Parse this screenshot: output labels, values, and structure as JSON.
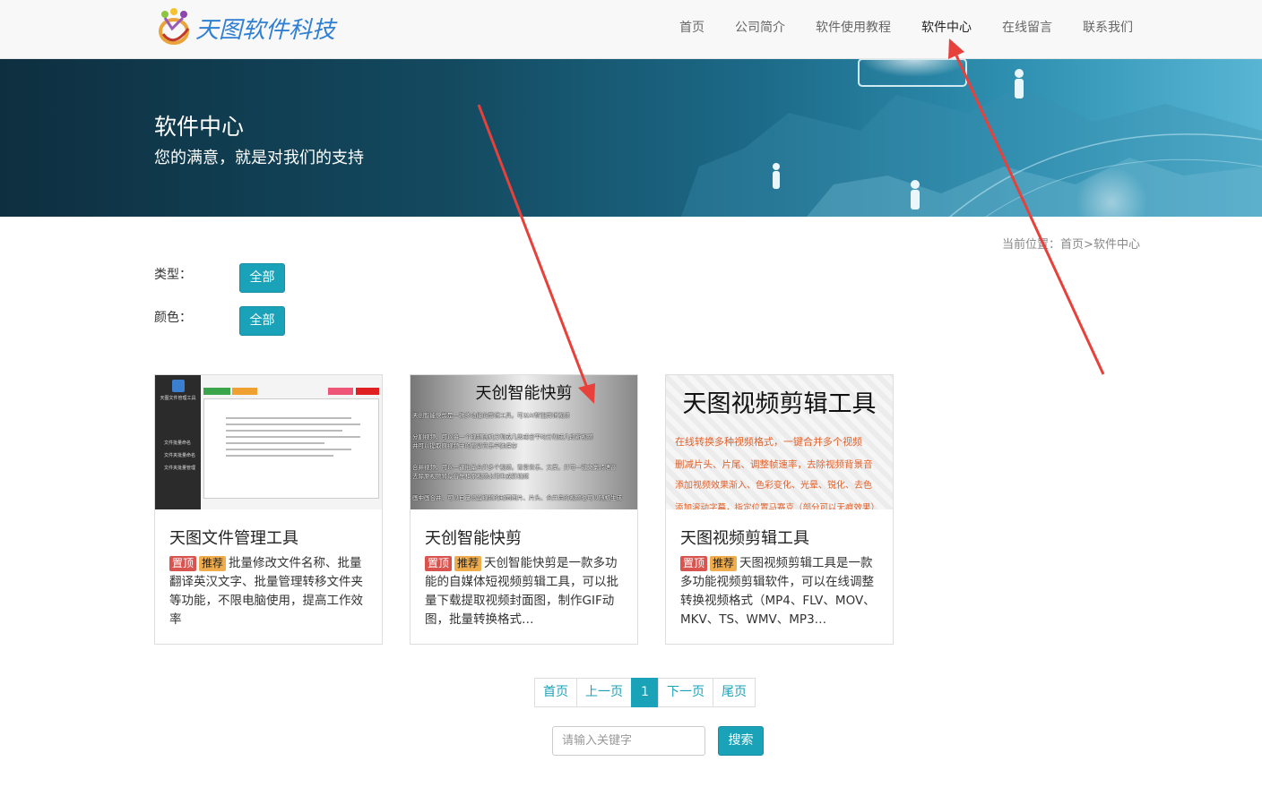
{
  "header": {
    "logo_text": "天图软件科技",
    "nav": [
      {
        "label": "首页"
      },
      {
        "label": "公司简介"
      },
      {
        "label": "软件使用教程"
      },
      {
        "label": "软件中心",
        "active": true
      },
      {
        "label": "在线留言"
      },
      {
        "label": "联系我们"
      }
    ]
  },
  "banner": {
    "title": "软件中心",
    "subtitle": "您的满意，就是对我们的支持"
  },
  "breadcrumb": {
    "prefix": "当前位置：",
    "home": "首页",
    "sep": ">",
    "current": "软件中心"
  },
  "filters": {
    "type_label": "类型：",
    "type_value": "全部",
    "color_label": "颜色：",
    "color_value": "全部"
  },
  "cards": [
    {
      "title": "天图文件管理工具",
      "tag_top": "置顶",
      "tag_rec": "推荐",
      "desc": "批量修改文件名称、批量翻译英汉文字、批量管理转移文件夹等功能，不限电脑使用，提高工作效率",
      "thumb": {
        "app_name": "天图文件管理工具",
        "menu": [
          "文件批量命名",
          "文件夹批量命名",
          "文件夹批量管理"
        ]
      }
    },
    {
      "title": "天创智能快剪",
      "tag_top": "置顶",
      "tag_rec": "推荐",
      "desc": "天创智能快剪是一款多功能的自媒体短视频剪辑工具，可以批量下载提取视频封面图，制作GIF动图，批量转换格式…",
      "thumb": {
        "heading": "天创智能快剪",
        "lines": [
          "天创智能快剪是一款多功能的剪辑工具，可以AI智能剪辑视频",
          "分割视频，可以将一个视频随机分割成几段或者平均分割成几段新视频",
          "并可以提取原视频中的背景音乐单独保存",
          "合并视频，可以一键批量合并多个视频，背景音乐、文案，并可一键文案转语音",
          "去除原视频背景音乐和原视频水印生成新视频",
          "画中画合并，可以自己设置视频的封面图片、片头、合并后的视频也可以随机生成"
        ]
      }
    },
    {
      "title": "天图视频剪辑工具",
      "tag_top": "置顶",
      "tag_rec": "推荐",
      "desc": "天图视频剪辑工具是一款多功能视频剪辑软件，可以在线调整转换视频格式（MP4、FLV、MOV、MKV、TS、WMV、MP3…",
      "thumb": {
        "heading": "天图视频剪辑工具",
        "lines": [
          "在线转换多种视频格式，一键合并多个视频",
          "删减片头、片尾、调整帧速率，去除视频背景音",
          "添加视频效果渐入、色彩变化、光晕、锐化、去色",
          "添加滚动字幕，指定位置马赛克（部分可以无痕效果）"
        ]
      }
    }
  ],
  "pager": {
    "first": "首页",
    "prev": "上一页",
    "current": "1",
    "next": "下一页",
    "last": "尾页"
  },
  "search": {
    "placeholder": "请输入关键字",
    "button": "搜索"
  },
  "colors": {
    "accent": "#1aa2b8",
    "tag_top": "#d9534f",
    "tag_rec": "#f0ad4e",
    "arrow": "#e8403a"
  }
}
